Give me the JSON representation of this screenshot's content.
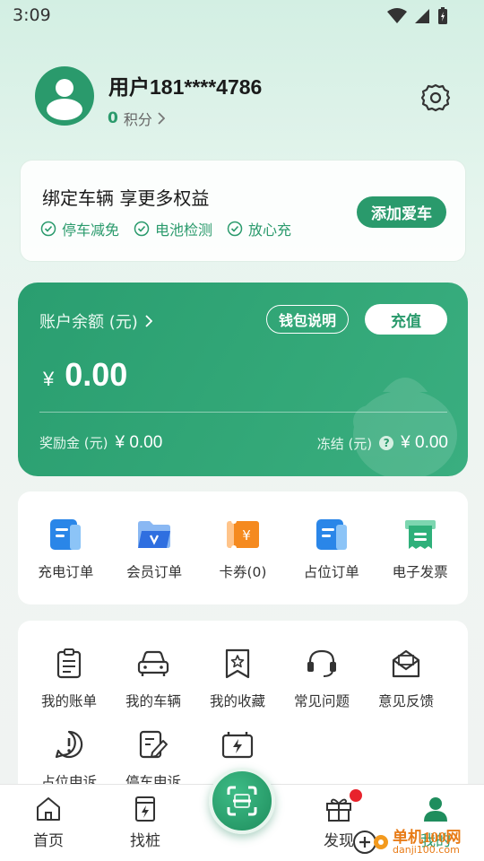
{
  "status_bar": {
    "time": "3:09"
  },
  "profile": {
    "username": "用户181****4786",
    "points_value": "0",
    "points_label": "积分"
  },
  "bind_card": {
    "title": "绑定车辆 享更多权益",
    "perks": [
      "停车减免",
      "电池检测",
      "放心充"
    ],
    "button": "添加爱车"
  },
  "wallet": {
    "balance_label": "账户余额 (元)",
    "explain_button": "钱包说明",
    "recharge_button": "充值",
    "currency": "¥",
    "balance": "0.00",
    "bonus_label": "奖励金 (元)",
    "bonus_value": "¥ 0.00",
    "frozen_label": "冻结 (元)",
    "frozen_value": "¥ 0.00"
  },
  "orders": [
    {
      "label": "充电订单",
      "icon": "charge-order-icon"
    },
    {
      "label": "会员订单",
      "icon": "member-folder-icon"
    },
    {
      "label": "卡券(0)",
      "icon": "coupon-icon"
    },
    {
      "label": "占位订单",
      "icon": "occupancy-order-icon"
    },
    {
      "label": "电子发票",
      "icon": "e-invoice-icon"
    }
  ],
  "tools": [
    {
      "label": "我的账单",
      "icon": "bill-icon"
    },
    {
      "label": "我的车辆",
      "icon": "car-icon"
    },
    {
      "label": "我的收藏",
      "icon": "favorite-icon"
    },
    {
      "label": "常见问题",
      "icon": "headset-icon"
    },
    {
      "label": "意见反馈",
      "icon": "feedback-icon"
    },
    {
      "label": "占位申诉",
      "icon": "alert-icon"
    },
    {
      "label": "停车申诉",
      "icon": "edit-icon"
    },
    {
      "label": "",
      "icon": "battery-charge-icon"
    }
  ],
  "nav": {
    "home": "首页",
    "find": "找桩",
    "discover": "发现",
    "mine": "我的"
  },
  "watermark": {
    "line1": "单机100网",
    "line2": "danji100.com"
  },
  "colors": {
    "brand": "#2a9a6c",
    "badge": "#e8232c"
  }
}
